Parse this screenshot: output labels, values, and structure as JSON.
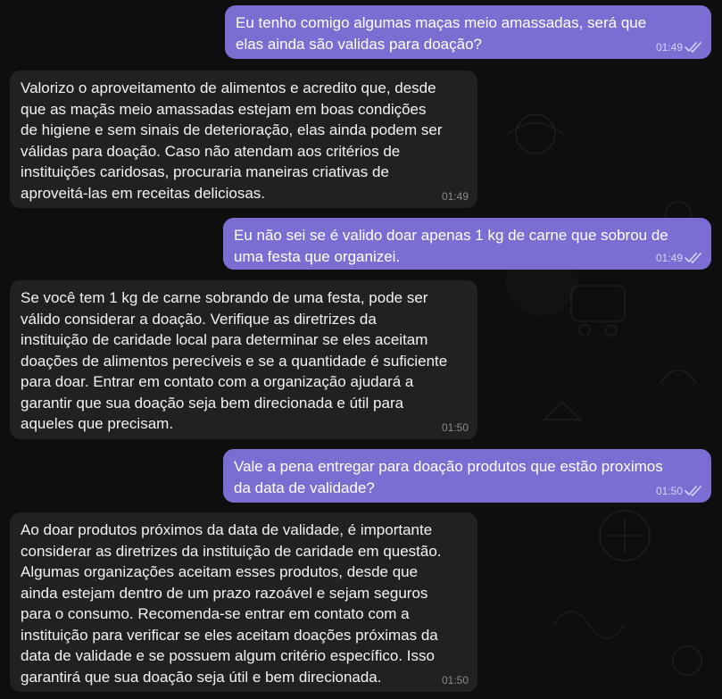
{
  "messages": [
    {
      "direction": "out",
      "text": "Eu tenho comigo algumas maças meio amassadas, será que\nelas ainda são validas para doação?",
      "time": "01:49",
      "status_icon": "double-check-icon"
    },
    {
      "direction": "in",
      "text": "Valorizo o aproveitamento de alimentos e acredito que, desde\nque as maçãs meio amassadas estejam em boas condições\nde higiene e sem sinais de deterioração, elas ainda podem ser\nválidas para doação. Caso não atendam aos critérios de\ninstituições caridosas, procuraria maneiras criativas de\naproveitá-las em receitas deliciosas.",
      "time": "01:49"
    },
    {
      "direction": "out",
      "text": "Eu não sei se é valido doar apenas 1 kg de carne que sobrou de\numa festa que organizei.",
      "time": "01:49",
      "status_icon": "double-check-icon"
    },
    {
      "direction": "in",
      "text": "Se você tem 1 kg de carne sobrando de uma festa, pode ser\nválido considerar a doação. Verifique as diretrizes da\ninstituição de caridade local para determinar se eles aceitam\ndoações de alimentos perecíveis e se a quantidade é suficiente\npara doar. Entrar em contato com a organização ajudará a\ngarantir que sua doação seja bem direcionada e útil para\naqueles que precisam.",
      "time": "01:50"
    },
    {
      "direction": "out",
      "text": "Vale a pena entregar para doação produtos que estão proximos\nda data de validade?",
      "time": "01:50",
      "status_icon": "double-check-icon"
    },
    {
      "direction": "in",
      "text": "Ao doar produtos próximos da data de validade, é importante\nconsiderar as diretrizes da instituição de caridade em questão.\nAlgumas organizações aceitam esses produtos, desde que\nainda estejam dentro de um prazo razoável e sejam seguros\npara o consumo. Recomenda-se entrar em contato com a\ninstituição para verificar se eles aceitam doações próximas da\ndata de validade e se possuem algum critério específico. Isso\ngarantirá que sua doação seja útil e bem direcionada.",
      "time": "01:50"
    }
  ],
  "colors": {
    "background": "#0e0e0e",
    "outgoing_bubble": "#7a6ed3",
    "incoming_bubble": "#212121"
  }
}
